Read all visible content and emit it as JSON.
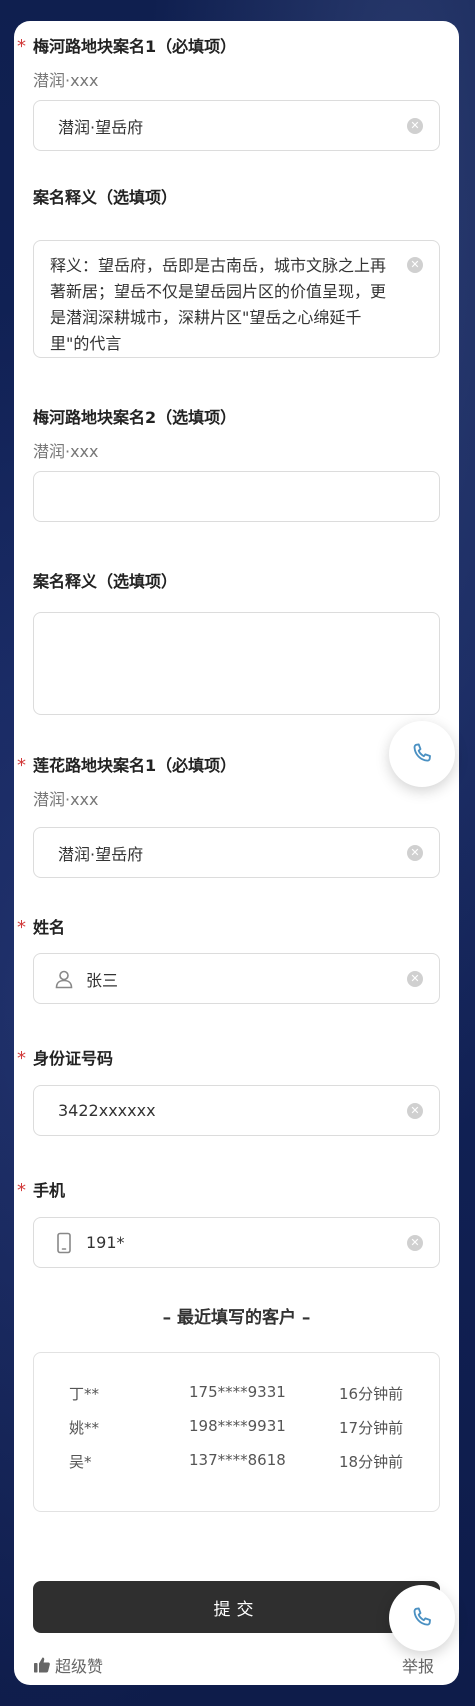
{
  "form": {
    "field1": {
      "label": "梅河路地块案名1（必填项）",
      "hint": "潜润·xxx",
      "value": "潜润·望岳府"
    },
    "field1_desc": {
      "label": "案名释义（选填项）",
      "value": "释义：望岳府，岳即是古南岳，城市文脉之上再著新居；望岳不仅是望岳园片区的价值呈现，更是潜润深耕城市，深耕片区\"望岳之心绵延千里\"的代言"
    },
    "field2": {
      "label": "梅河路地块案名2（选填项）",
      "hint": "潜润·xxx",
      "value": ""
    },
    "field2_desc": {
      "label": "案名释义（选填项）",
      "value": ""
    },
    "field3": {
      "label": "莲花路地块案名1（必填项）",
      "hint": "潜润·xxx",
      "value": "潜润·望岳府"
    },
    "name": {
      "label": "姓名",
      "value": "张三",
      "icon": "user-icon"
    },
    "id_card": {
      "label": "身份证号码",
      "value": "3422xxxxxx"
    },
    "phone": {
      "label": "手机",
      "value": "191*",
      "icon": "mobile-phone-icon"
    },
    "required_mark": "*",
    "required_color": "#d23a3a"
  },
  "recent": {
    "title": "– 最近填写的客户 –",
    "rows": [
      {
        "name": "丁**",
        "phone": "175****9331",
        "time": "16分钟前"
      },
      {
        "name": "姚**",
        "phone": "198****9931",
        "time": "17分钟前"
      },
      {
        "name": "吴*",
        "phone": "137****8618",
        "time": "18分钟前"
      }
    ]
  },
  "actions": {
    "submit_label": "提交",
    "like_label": "超级赞",
    "report_label": "举报"
  },
  "icons": {
    "phone_fab": "phone-call-icon",
    "like": "thumbs-up-icon",
    "clear": "clear-icon"
  },
  "colors": {
    "accent_phone": "#4a90c2",
    "submit_bg": "#2f2f2f",
    "page_bg": "#0f1e4b"
  }
}
